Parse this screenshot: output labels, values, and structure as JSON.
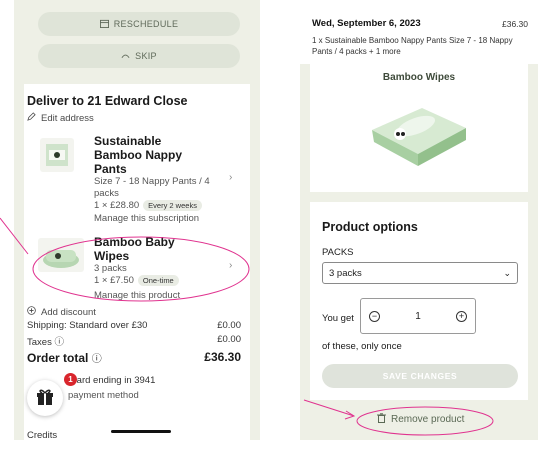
{
  "left": {
    "reschedule_label": "RESCHEDULE",
    "skip_label": "SKIP",
    "deliver_title": "Deliver to 21 Edward Close",
    "edit_address": "Edit address",
    "products": [
      {
        "name_lines": [
          "Sustainable",
          "Bamboo Nappy",
          "Pants"
        ],
        "meta_lines": [
          "Size 7 - 18 Nappy Pants / 4",
          "packs"
        ],
        "price": "1 × £28.80",
        "badge": "Every 2 weeks",
        "manage": "Manage this subscription"
      },
      {
        "name_lines": [
          "Bamboo Baby",
          "Wipes"
        ],
        "meta_lines": [
          "3 packs"
        ],
        "price": "1 × £7.50",
        "badge": "One-time",
        "manage": "Manage this product"
      }
    ],
    "add_discount": "Add discount",
    "shipping_label": "Shipping: Standard over £30",
    "shipping_value": "£0.00",
    "taxes_label": "Taxes",
    "taxes_value": "£0.00",
    "order_total_label": "Order total",
    "order_total_value": "£36.30",
    "card_text": "o card ending in 3941",
    "payment_text": "payment method",
    "credits_label": "Credits",
    "gift_count": "1"
  },
  "right": {
    "order_date": "Wed, September 6, 2023",
    "order_price": "£36.30",
    "order_desc": "1 x Sustainable Bamboo Nappy Pants Size 7 - 18 Nappy Pants / 4 packs + 1 more",
    "product_image_title": "Bamboo Wipes",
    "options_title": "Product options",
    "packs_label": "PACKS",
    "packs_value": "3 packs",
    "you_get": "You get",
    "quantity": "1",
    "of_these": "of these, only once",
    "save_label": "SAVE CHANGES",
    "remove_label": "Remove product"
  },
  "colors": {
    "panel_bg": "#eef0e6",
    "annotation": "#e0338f",
    "badge_red": "#d9262d"
  }
}
